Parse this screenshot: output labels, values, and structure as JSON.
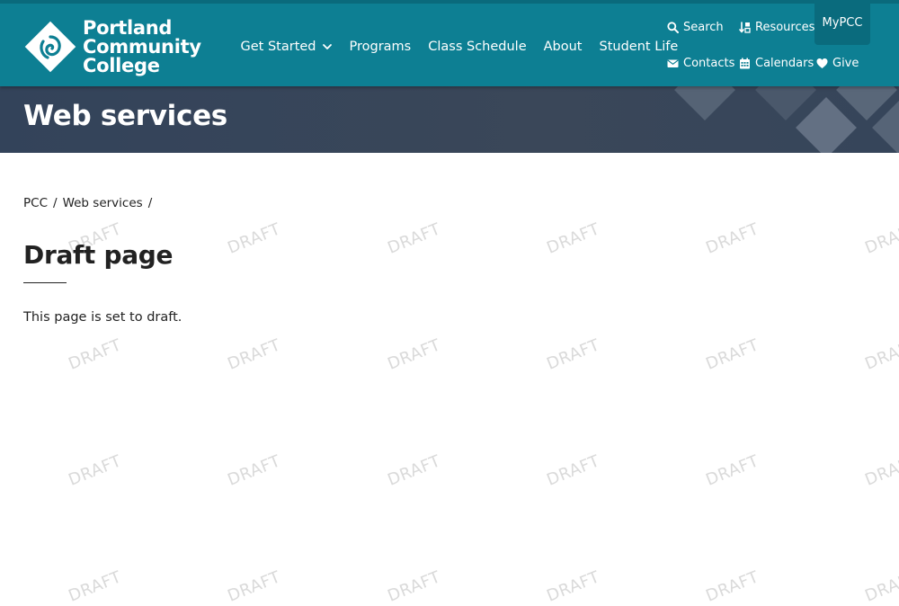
{
  "header": {
    "logo": {
      "line1": "Portland",
      "line2": "Community",
      "line3": "College"
    },
    "nav": [
      {
        "label": "Get Started",
        "has_dropdown": true
      },
      {
        "label": "Programs"
      },
      {
        "label": "Class Schedule"
      },
      {
        "label": "About"
      },
      {
        "label": "Student Life"
      }
    ],
    "utility": {
      "search": "Search",
      "resources": "Resources",
      "mypcc": "MyPCC",
      "contacts": "Contacts",
      "calendars": "Calendars",
      "give": "Give"
    }
  },
  "banner": {
    "title": "Web services"
  },
  "breadcrumb": [
    "PCC",
    "Web services"
  ],
  "page": {
    "title": "Draft page",
    "body": "This page is set to draft."
  },
  "watermark": {
    "text": "DRAFT"
  },
  "colors": {
    "header_bg": "#0d7f93",
    "banner_bg": "#36455a",
    "watermark": "#dadada"
  },
  "icons": [
    "search-icon",
    "resources-icon",
    "envelope-icon",
    "calendar-icon",
    "heart-icon",
    "chevron-down-icon",
    "pcc-logo-icon"
  ]
}
